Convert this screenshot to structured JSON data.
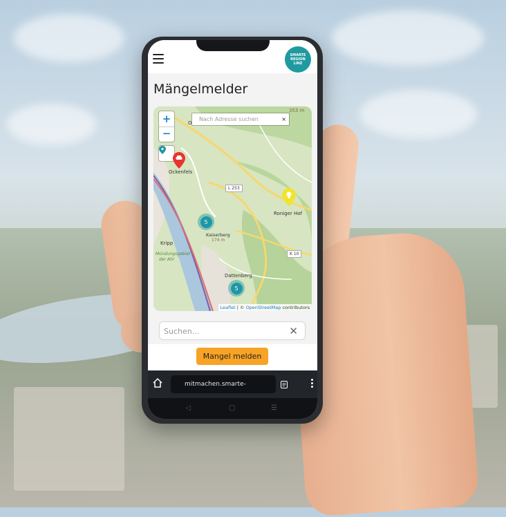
{
  "app": {
    "page_title": "Mängelmelder",
    "logo_lines": [
      "SMARTE",
      "REGION",
      "LINZ"
    ]
  },
  "map": {
    "zoom_in": "+",
    "zoom_out": "−",
    "search_placeholder": "Nach Adresse suchen",
    "search_clear": "×",
    "labels": {
      "ockenfels": "Ockenfels",
      "roniger_hof": "Roniger Hof",
      "kripp": "Kripp",
      "kaiserberg": "Kaiserberg",
      "kaiserberg_elev": "174 m",
      "dattenberg": "Dattenberg",
      "muendung_1": "Mündungsgebiet",
      "muendung_2": "der Ahr",
      "elev_top": "353 m",
      "road_l253": "L 253",
      "road_k10": "K 10",
      "top_o": "O"
    },
    "clusters": [
      {
        "count": "5"
      },
      {
        "count": "5"
      }
    ],
    "attribution": {
      "leaflet": "Leaflet",
      "sep": " | © ",
      "osm": "OpenStreetMap",
      "suffix": " contributors"
    }
  },
  "search": {
    "placeholder": "Suchen...",
    "clear": "✕"
  },
  "actions": {
    "report_label": "Mangel melden"
  },
  "browser": {
    "url": "mitmachen.smarte-"
  },
  "colors": {
    "brand_teal": "#1f9aa0",
    "report_orange": "#f7a325",
    "marker_red": "#e8352f",
    "marker_yellow": "#f1e42a"
  }
}
